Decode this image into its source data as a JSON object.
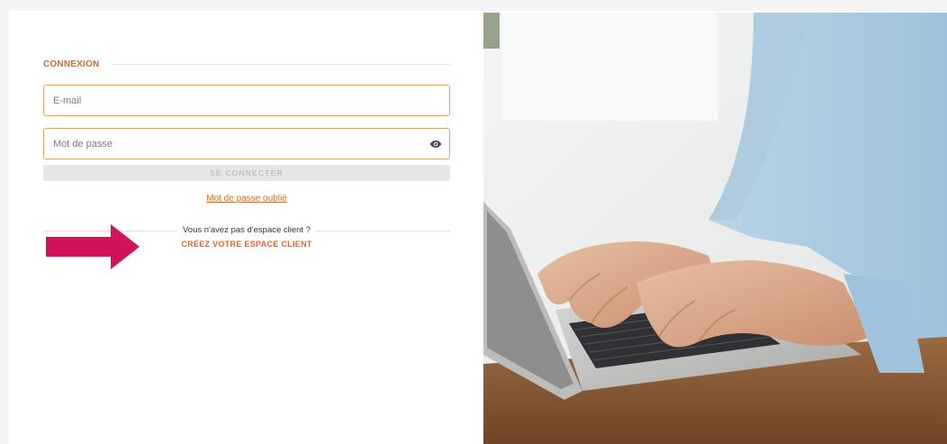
{
  "login": {
    "title": "CONNEXION",
    "email": {
      "placeholder": "E-mail",
      "value": ""
    },
    "password": {
      "placeholder": "Mot de passe",
      "value": ""
    },
    "submit_label": "SE CONNECTER",
    "forgot_label": "Mot de passe oublié",
    "no_account_text": "Vous n'avez pas d'espace client ?",
    "create_account_label": "CRÉEZ VOTRE ESPACE CLIENT"
  },
  "icons": {
    "password_toggle": "eye-icon",
    "annotation": "arrow-right-icon",
    "photo": "laptop-typing-photo"
  },
  "colors": {
    "accent": "#d9672b",
    "field_border": "#e8a46d",
    "button_disabled": "#e6e6e6",
    "annotation_arrow": "#d0135a"
  }
}
